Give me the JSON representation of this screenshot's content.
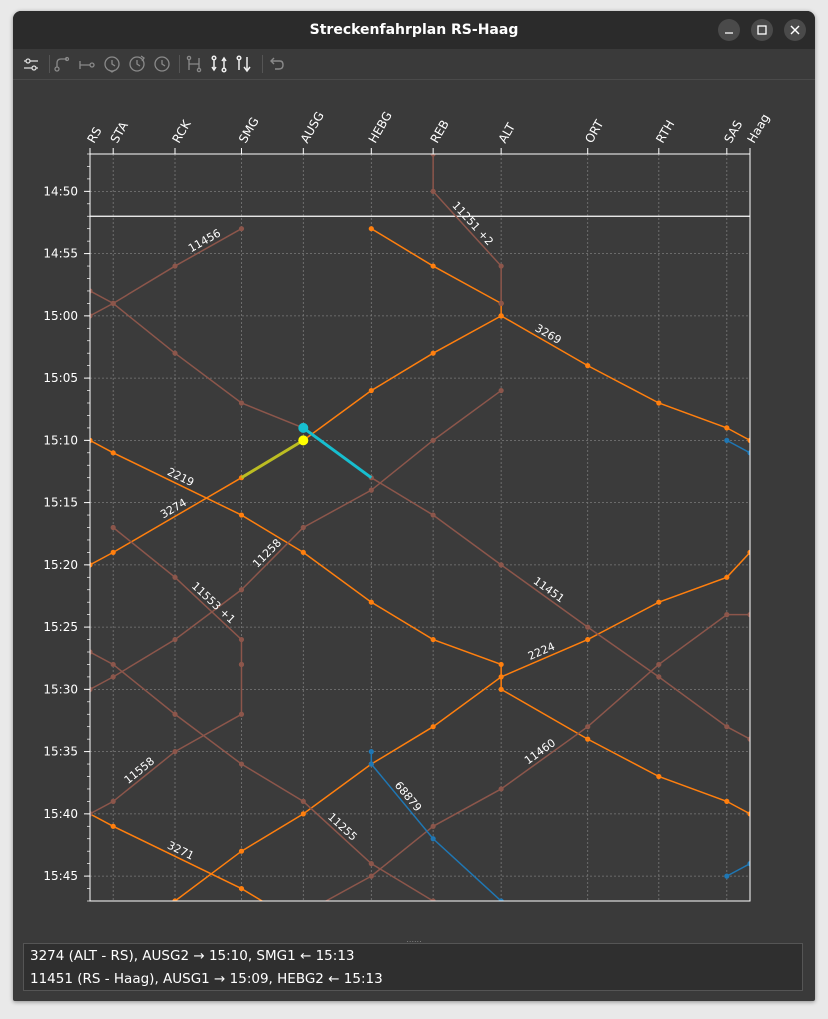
{
  "window": {
    "title": "Streckenfahrplan RS-Haag"
  },
  "titlebar_buttons": [
    {
      "name": "minimize-button",
      "icon": "minimize-icon"
    },
    {
      "name": "maximize-button",
      "icon": "maximize-icon"
    },
    {
      "name": "close-button",
      "icon": "close-icon"
    }
  ],
  "toolbar": [
    {
      "name": "settings-button",
      "icon": "sliders-icon",
      "enabled": true
    },
    {
      "name": "connection-button",
      "icon": "route-branch-icon",
      "enabled": false
    },
    {
      "name": "link-button",
      "icon": "route-link-icon",
      "enabled": false
    },
    {
      "name": "time-earlier-button",
      "icon": "clock-down-icon",
      "enabled": false
    },
    {
      "name": "time-later-button",
      "icon": "clock-up-icon",
      "enabled": false
    },
    {
      "name": "time-reset-button",
      "icon": "clock-icon",
      "enabled": false
    },
    {
      "name": "swap-connect-button",
      "icon": "swap-nodes-icon",
      "enabled": false
    },
    {
      "name": "swap-trains-button",
      "icon": "swap-arrows-icon",
      "enabled": true
    },
    {
      "name": "swap-down-button",
      "icon": "swap-down-icon",
      "enabled": true
    },
    {
      "name": "undo-button",
      "icon": "undo-icon",
      "enabled": false
    }
  ],
  "chart_data": {
    "type": "line",
    "title": "",
    "xlabel": "",
    "ylabel": "",
    "stations": [
      "RS",
      "STA",
      "RCK",
      "SMG",
      "AUSG",
      "HEBG",
      "REB",
      "ALT",
      "ORT",
      "RTH",
      "SAS",
      "Haag"
    ],
    "station_km": [
      0,
      1.5,
      5.5,
      9.8,
      13.8,
      18.2,
      22.2,
      26.6,
      32.2,
      36.8,
      41.2,
      42.7
    ],
    "time_axis_direction": "down",
    "ylim": [
      "14:47",
      "15:47"
    ],
    "yticks": [
      "14:50",
      "14:55",
      "15:00",
      "15:05",
      "15:10",
      "15:15",
      "15:20",
      "15:25",
      "15:30",
      "15:35",
      "15:40",
      "15:45"
    ],
    "minor_tick_minutes": 1,
    "grid": true,
    "colors": {
      "background": "#3b3b3b",
      "grid": "#7a7a7a",
      "orange_trains": "#ff7f0e",
      "brown_trains": "#8c564b",
      "blue_trains": "#1f77b4",
      "selected_cyan": "#17becf",
      "selected_olive": "#bcbd22",
      "selected_yellow": "#ffff00",
      "frame": "#ffffff"
    },
    "current_time": "14:52",
    "series": [
      {
        "name": "3269",
        "color": "orange",
        "points": [
          [
            "HEBG",
            "14:53"
          ],
          [
            "REB",
            "14:56"
          ],
          [
            "ALT",
            "14:59"
          ],
          [
            "ALT",
            "15:00"
          ],
          [
            "ORT",
            "15:04"
          ],
          [
            "RTH",
            "15:07"
          ],
          [
            "SAS",
            "15:09"
          ],
          [
            "Haag",
            "15:10"
          ]
        ]
      },
      {
        "name": "3274",
        "color": "orange",
        "points": [
          [
            "ALT",
            "15:00"
          ],
          [
            "REB",
            "15:03"
          ],
          [
            "HEBG",
            "15:06"
          ],
          [
            "AUSG",
            "15:10"
          ],
          [
            "SMG",
            "15:13"
          ],
          [
            "STA",
            "15:19"
          ],
          [
            "RS",
            "15:20"
          ]
        ]
      },
      {
        "name": "2219",
        "color": "orange",
        "points": [
          [
            "RS",
            "15:10"
          ],
          [
            "STA",
            "15:11"
          ],
          [
            "SMG",
            "15:16"
          ],
          [
            "AUSG",
            "15:19"
          ],
          [
            "HEBG",
            "15:23"
          ],
          [
            "REB",
            "15:26"
          ],
          [
            "ALT",
            "15:28"
          ],
          [
            "ALT",
            "15:30"
          ],
          [
            "ORT",
            "15:34"
          ],
          [
            "RTH",
            "15:37"
          ],
          [
            "SAS",
            "15:39"
          ],
          [
            "Haag",
            "15:40"
          ]
        ]
      },
      {
        "name": "2224",
        "color": "orange",
        "points": [
          [
            "Haag",
            "15:19"
          ],
          [
            "SAS",
            "15:21"
          ],
          [
            "RTH",
            "15:23"
          ],
          [
            "ORT",
            "15:26"
          ],
          [
            "ALT",
            "15:29"
          ],
          [
            "REB",
            "15:33"
          ],
          [
            "HEBG",
            "15:36"
          ],
          [
            "AUSG",
            "15:40"
          ],
          [
            "SMG",
            "15:43"
          ],
          [
            "RCK",
            "15:47"
          ]
        ]
      },
      {
        "name": "3271",
        "color": "orange",
        "points": [
          [
            "RS",
            "15:40"
          ],
          [
            "STA",
            "15:41"
          ],
          [
            "SMG",
            "15:46"
          ],
          [
            "AUSG",
            "15:49"
          ]
        ]
      },
      {
        "name": "11456",
        "color": "brown",
        "points": [
          [
            "RS",
            "15:00"
          ],
          [
            "STA",
            "14:59"
          ],
          [
            "RCK",
            "14:56"
          ],
          [
            "SMG",
            "14:53"
          ]
        ]
      },
      {
        "name": "11251 +2",
        "color": "brown",
        "points": [
          [
            "REB",
            "14:47"
          ],
          [
            "REB",
            "14:50"
          ],
          [
            "ALT",
            "14:56"
          ],
          [
            "ALT",
            "14:59"
          ]
        ]
      },
      {
        "name": "11451",
        "color": "brown",
        "points": [
          [
            "RS",
            "14:58"
          ],
          [
            "STA",
            "14:59"
          ],
          [
            "RCK",
            "15:03"
          ],
          [
            "SMG",
            "15:07"
          ],
          [
            "AUSG",
            "15:09"
          ],
          [
            "HEBG",
            "15:13"
          ],
          [
            "REB",
            "15:16"
          ],
          [
            "ALT",
            "15:20"
          ],
          [
            "ORT",
            "15:25"
          ],
          [
            "RTH",
            "15:29"
          ],
          [
            "SAS",
            "15:33"
          ],
          [
            "Haag",
            "15:34"
          ]
        ]
      },
      {
        "name": "11258",
        "color": "brown",
        "points": [
          [
            "RS",
            "15:30"
          ],
          [
            "STA",
            "15:29"
          ],
          [
            "RCK",
            "15:26"
          ],
          [
            "SMG",
            "15:22"
          ],
          [
            "AUSG",
            "15:17"
          ],
          [
            "HEBG",
            "15:14"
          ],
          [
            "REB",
            "15:10"
          ],
          [
            "ALT",
            "15:06"
          ]
        ]
      },
      {
        "name": "11553 +1",
        "color": "brown",
        "points": [
          [
            "STA",
            "15:17"
          ],
          [
            "RCK",
            "15:21"
          ],
          [
            "SMG",
            "15:26"
          ],
          [
            "SMG",
            "15:28"
          ]
        ]
      },
      {
        "name": "11255",
        "color": "brown",
        "points": [
          [
            "RS",
            "15:27"
          ],
          [
            "STA",
            "15:28"
          ],
          [
            "RCK",
            "15:32"
          ],
          [
            "SMG",
            "15:36"
          ],
          [
            "AUSG",
            "15:39"
          ],
          [
            "HEBG",
            "15:44"
          ],
          [
            "REB",
            "15:47"
          ]
        ]
      },
      {
        "name": "11558",
        "color": "brown",
        "points": [
          [
            "RS",
            "15:40"
          ],
          [
            "STA",
            "15:39"
          ],
          [
            "RCK",
            "15:35"
          ],
          [
            "SMG",
            "15:32"
          ],
          [
            "SMG",
            "15:28"
          ]
        ]
      },
      {
        "name": "11460",
        "color": "brown",
        "points": [
          [
            "Haag",
            "15:24"
          ],
          [
            "SAS",
            "15:24"
          ],
          [
            "RTH",
            "15:28"
          ],
          [
            "ORT",
            "15:33"
          ],
          [
            "ALT",
            "15:38"
          ],
          [
            "REB",
            "15:41"
          ],
          [
            "HEBG",
            "15:45"
          ],
          [
            "AUSG",
            "15:48"
          ]
        ]
      },
      {
        "name": "68879",
        "color": "blue",
        "points": [
          [
            "HEBG",
            "15:35"
          ],
          [
            "HEBG",
            "15:36"
          ],
          [
            "REB",
            "15:42"
          ],
          [
            "ALT",
            "15:47"
          ]
        ]
      },
      {
        "name": "",
        "color": "blue",
        "points": [
          [
            "SAS",
            "15:10"
          ],
          [
            "Haag",
            "15:11"
          ]
        ]
      },
      {
        "name": "",
        "color": "blue",
        "points": [
          [
            "SAS",
            "15:45"
          ],
          [
            "Haag",
            "15:44"
          ]
        ]
      }
    ],
    "selected_segments": [
      {
        "train": "3274",
        "from": [
          "AUSG",
          "15:10"
        ],
        "to": [
          "SMG",
          "15:13"
        ],
        "color": "olive"
      },
      {
        "train": "11451",
        "from": [
          "AUSG",
          "15:09"
        ],
        "to": [
          "HEBG",
          "15:13"
        ],
        "color": "cyan"
      }
    ]
  },
  "status": {
    "line1": "3274 (ALT - RS), AUSG2 → 15:10, SMG1 ← 15:13",
    "line2": "11451 (RS - Haag), AUSG1 → 15:09, HEBG2 ← 15:13"
  }
}
